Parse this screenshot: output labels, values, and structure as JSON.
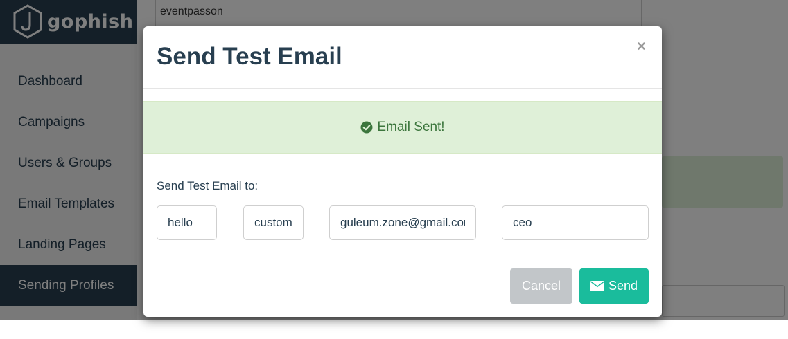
{
  "app": {
    "name": "gophish"
  },
  "sidebar": {
    "items": [
      {
        "label": "Dashboard"
      },
      {
        "label": "Campaigns"
      },
      {
        "label": "Users & Groups"
      },
      {
        "label": "Email Templates"
      },
      {
        "label": "Landing Pages"
      },
      {
        "label": "Sending Profiles",
        "active": true
      }
    ]
  },
  "background_form": {
    "partial_field_value": "eventpasson"
  },
  "modal": {
    "title": "Send Test Email",
    "close_symbol": "×",
    "alert": {
      "icon": "check-circle-icon",
      "message": "Email Sent!"
    },
    "send_to_label": "Send Test Email to:",
    "fields": {
      "first_name": "hello",
      "last_name": "customer",
      "email": "guleum.zone@gmail.com",
      "position": "ceo"
    },
    "buttons": {
      "cancel": "Cancel",
      "send": "Send",
      "send_icon": "envelope-icon"
    }
  },
  "colors": {
    "navbar": "#283f50",
    "accent": "#1abc9c",
    "alert_bg": "#dff0d8",
    "alert_text": "#3c763d",
    "cancel_bg": "#c2c6c9"
  }
}
